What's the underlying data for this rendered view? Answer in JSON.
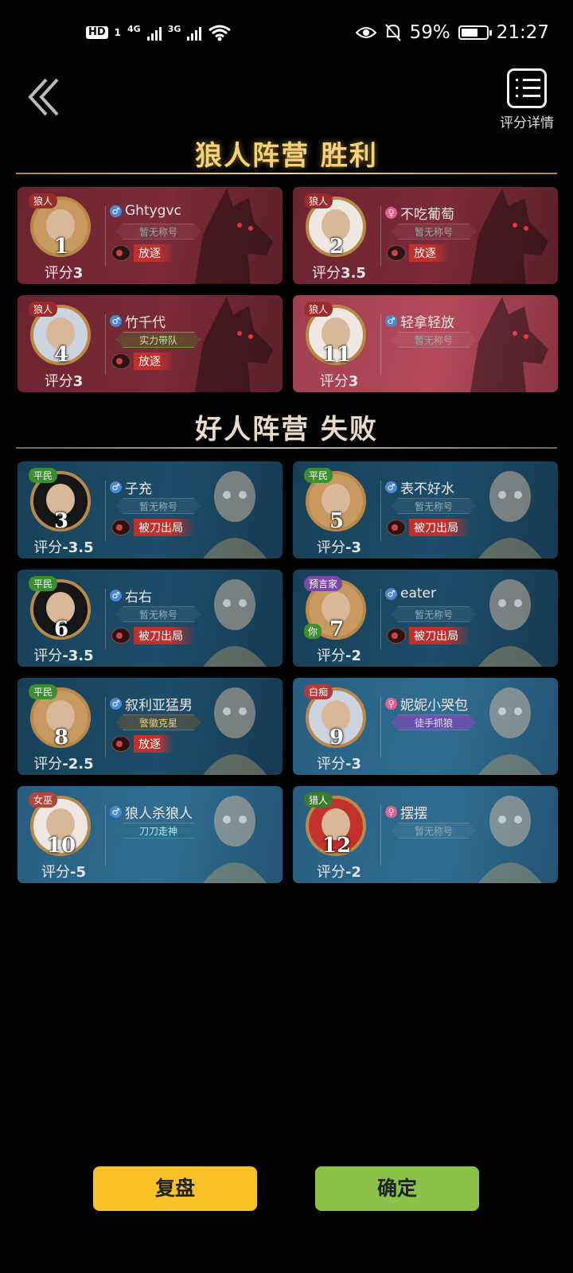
{
  "status_bar": {
    "hd": "HD",
    "sim1": "1",
    "net1": "4G",
    "net2": "3G",
    "battery": "59%",
    "time": "21:27"
  },
  "header": {
    "detail_label": "评分详情"
  },
  "sections": {
    "wolf_title": "狼人阵营  胜利",
    "good_title": "好人阵营  失败"
  },
  "wolves": [
    {
      "role": "狼人",
      "seat": "1",
      "name": "Ghtygvc",
      "gender": "m",
      "title": "暂无称号",
      "status": "放逐",
      "score": "3"
    },
    {
      "role": "狼人",
      "seat": "2",
      "name": "不吃葡萄",
      "gender": "f",
      "title": "暂无称号",
      "status": "放逐",
      "score": "3.5"
    },
    {
      "role": "狼人",
      "seat": "4",
      "name": "竹千代",
      "gender": "m",
      "title": "实力带队",
      "status": "放逐",
      "score": "3"
    },
    {
      "role": "狼人",
      "seat": "11",
      "name": "轻拿轻放",
      "gender": "m",
      "title": "暂无称号",
      "status": "",
      "score": "3"
    }
  ],
  "goods": [
    {
      "role": "平民",
      "seat": "3",
      "name": "子充",
      "gender": "m",
      "title": "暂无称号",
      "status": "被刀出局",
      "score": "-3.5"
    },
    {
      "role": "平民",
      "seat": "5",
      "name": "表不好水",
      "gender": "m",
      "title": "暂无称号",
      "status": "被刀出局",
      "score": "-3"
    },
    {
      "role": "平民",
      "seat": "6",
      "name": "右右",
      "gender": "m",
      "title": "暂无称号",
      "status": "被刀出局",
      "score": "-3.5"
    },
    {
      "role": "预言家",
      "seat": "7",
      "name": "eater",
      "gender": "m",
      "title": "暂无称号",
      "status": "被刀出局",
      "score": "-2",
      "you": "你"
    },
    {
      "role": "平民",
      "seat": "8",
      "name": "叙利亚猛男",
      "gender": "m",
      "title": "警徽克星",
      "status": "放逐",
      "score": "-2.5"
    },
    {
      "role": "白痴",
      "seat": "9",
      "name": "妮妮小哭包",
      "gender": "f",
      "title": "徒手抓狼",
      "status": "",
      "score": "-3"
    },
    {
      "role": "女巫",
      "seat": "10",
      "name": "狼人杀狼人",
      "gender": "m",
      "title": "刀刀走神",
      "status": "",
      "score": "-5"
    },
    {
      "role": "猎人",
      "seat": "12",
      "name": "摆摆",
      "gender": "f",
      "title": "暂无称号",
      "status": "",
      "score": "-2"
    }
  ],
  "score_prefix": "评分",
  "buttons": {
    "replay": "复盘",
    "confirm": "确定"
  },
  "colors": {
    "win_title": "#f5d27a",
    "replay_button": "#f8c227",
    "confirm_button": "#8bc34a"
  }
}
